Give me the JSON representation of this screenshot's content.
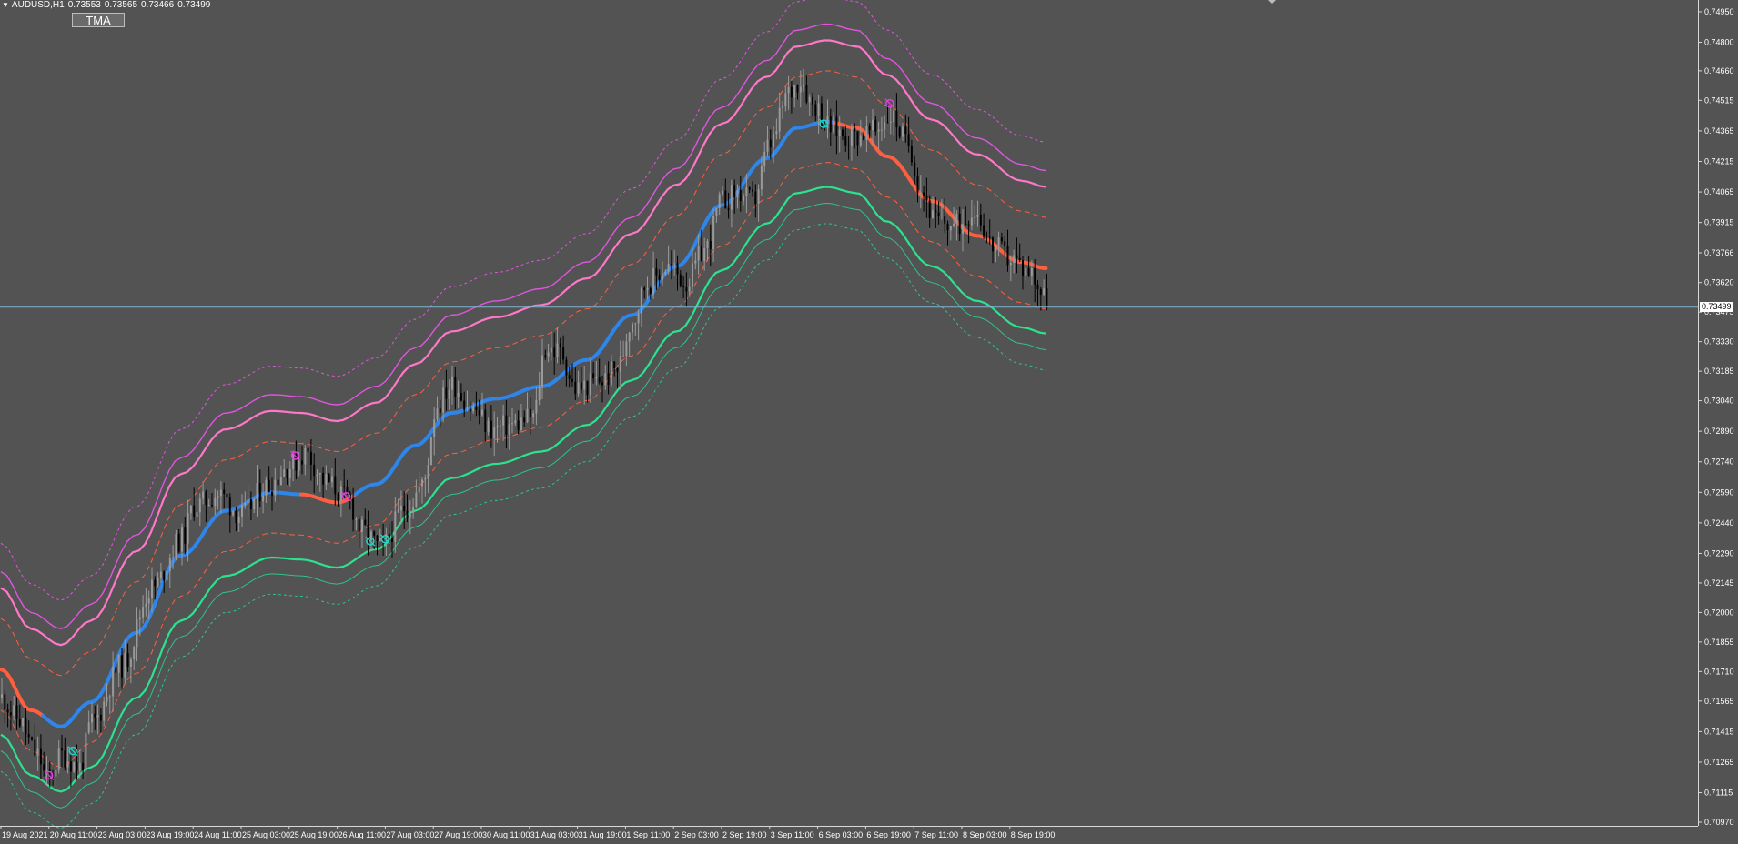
{
  "header": {
    "symbol": "AUDUSD,H1",
    "open": "0.73553",
    "high": "0.73565",
    "low": "0.73466",
    "close": "0.73499"
  },
  "indicator_button": {
    "label": "TMA"
  },
  "current_price_label": "0.73499",
  "colors": {
    "background": "#535353",
    "axis": "#d8d8d8",
    "bull_candle": "#9a9a9a",
    "bear_candle": "#000000",
    "mid_up": "#2f86ea",
    "mid_down": "#ff5f3f",
    "upper_1": "#ff77c8",
    "upper_2": "#e055e0",
    "lower_1": "#2de28f",
    "lower_2": "#2ec48a",
    "price_line": "#7eb3d1"
  },
  "chart_data": {
    "type": "candlestick",
    "title": "AUDUSD,H1",
    "ylim": [
      0.7097,
      0.7499
    ],
    "y_ticks": [
      "0.74950",
      "0.74800",
      "0.74660",
      "0.74515",
      "0.74365",
      "0.74215",
      "0.74065",
      "0.73915",
      "0.73766",
      "0.73620",
      "0.73475",
      "0.73330",
      "0.73185",
      "0.73040",
      "0.72890",
      "0.72740",
      "0.72590",
      "0.72440",
      "0.72290",
      "0.72145",
      "0.72000",
      "0.71855",
      "0.71710",
      "0.71565",
      "0.71415",
      "0.71265",
      "0.71115",
      "0.70970"
    ],
    "x_ticks": [
      "19 Aug 2021",
      "20 Aug 11:00",
      "23 Aug 03:00",
      "23 Aug 19:00",
      "24 Aug 11:00",
      "25 Aug 03:00",
      "25 Aug 19:00",
      "26 Aug 11:00",
      "27 Aug 03:00",
      "27 Aug 19:00",
      "30 Aug 11:00",
      "31 Aug 03:00",
      "31 Aug 19:00",
      "1 Sep 11:00",
      "2 Sep 03:00",
      "2 Sep 19:00",
      "3 Sep 11:00",
      "6 Sep 03:00",
      "6 Sep 19:00",
      "7 Sep 11:00",
      "8 Sep 03:00",
      "8 Sep 19:00"
    ],
    "x_tick_index": [
      0,
      16,
      32,
      48,
      64,
      80,
      96,
      112,
      128,
      144,
      160,
      176,
      192,
      208,
      224,
      240,
      256,
      272,
      288,
      304,
      320,
      336
    ],
    "bar_count": 356,
    "current_price": 0.73499,
    "tma_center_keypoints": [
      [
        0,
        0.7172
      ],
      [
        10,
        0.7152
      ],
      [
        20,
        0.7144
      ],
      [
        30,
        0.7156
      ],
      [
        45,
        0.719
      ],
      [
        60,
        0.7228
      ],
      [
        75,
        0.725
      ],
      [
        90,
        0.7259
      ],
      [
        100,
        0.7258
      ],
      [
        112,
        0.7254
      ],
      [
        125,
        0.7263
      ],
      [
        138,
        0.7282
      ],
      [
        150,
        0.7298
      ],
      [
        165,
        0.7305
      ],
      [
        180,
        0.7311
      ],
      [
        195,
        0.7324
      ],
      [
        210,
        0.7346
      ],
      [
        225,
        0.737
      ],
      [
        240,
        0.74
      ],
      [
        255,
        0.7423
      ],
      [
        265,
        0.7438
      ],
      [
        275,
        0.7441
      ],
      [
        285,
        0.7438
      ],
      [
        295,
        0.7424
      ],
      [
        310,
        0.7402
      ],
      [
        325,
        0.7385
      ],
      [
        340,
        0.7372
      ],
      [
        348,
        0.7369
      ]
    ],
    "band_offsets": {
      "upper_1": 0.004,
      "upper_2": 0.0048,
      "upper_3": 0.0062,
      "upper_inner": 0.0025,
      "lower_inner": -0.002,
      "lower_1": -0.0032,
      "lower_2": -0.004,
      "lower_3": -0.005
    },
    "tma_trend": [
      {
        "from": 0,
        "to": 14,
        "dir": "down"
      },
      {
        "from": 14,
        "to": 100,
        "dir": "up"
      },
      {
        "from": 100,
        "to": 118,
        "dir": "down"
      },
      {
        "from": 118,
        "to": 278,
        "dir": "up"
      },
      {
        "from": 278,
        "to": 348,
        "dir": "down"
      }
    ],
    "price_keypoints": [
      [
        0,
        0.7158
      ],
      [
        5,
        0.7148
      ],
      [
        12,
        0.713
      ],
      [
        15,
        0.7118
      ],
      [
        20,
        0.713
      ],
      [
        26,
        0.7124
      ],
      [
        30,
        0.7146
      ],
      [
        40,
        0.7174
      ],
      [
        50,
        0.7212
      ],
      [
        60,
        0.7236
      ],
      [
        64,
        0.7252
      ],
      [
        72,
        0.7258
      ],
      [
        80,
        0.7248
      ],
      [
        88,
        0.7262
      ],
      [
        96,
        0.7272
      ],
      [
        101,
        0.7278
      ],
      [
        108,
        0.7264
      ],
      [
        115,
        0.7256
      ],
      [
        120,
        0.724
      ],
      [
        126,
        0.7232
      ],
      [
        135,
        0.7252
      ],
      [
        140,
        0.7262
      ],
      [
        145,
        0.7302
      ],
      [
        150,
        0.7312
      ],
      [
        157,
        0.73
      ],
      [
        163,
        0.729
      ],
      [
        170,
        0.7292
      ],
      [
        177,
        0.7296
      ],
      [
        181,
        0.733
      ],
      [
        186,
        0.7328
      ],
      [
        191,
        0.731
      ],
      [
        200,
        0.7314
      ],
      [
        205,
        0.732
      ],
      [
        210,
        0.7344
      ],
      [
        215,
        0.7362
      ],
      [
        222,
        0.737
      ],
      [
        228,
        0.7362
      ],
      [
        234,
        0.7378
      ],
      [
        240,
        0.7402
      ],
      [
        245,
        0.7406
      ],
      [
        250,
        0.7402
      ],
      [
        256,
        0.743
      ],
      [
        262,
        0.7455
      ],
      [
        266,
        0.7462
      ],
      [
        270,
        0.745
      ],
      [
        276,
        0.7438
      ],
      [
        282,
        0.7434
      ],
      [
        290,
        0.7436
      ],
      [
        296,
        0.7444
      ],
      [
        302,
        0.743
      ],
      [
        306,
        0.7408
      ],
      [
        311,
        0.7392
      ],
      [
        318,
        0.739
      ],
      [
        324,
        0.7398
      ],
      [
        330,
        0.738
      ],
      [
        336,
        0.7374
      ],
      [
        342,
        0.7368
      ],
      [
        348,
        0.7354
      ]
    ],
    "markers": [
      {
        "bar": 16,
        "price": 0.712,
        "type": "sell"
      },
      {
        "bar": 24,
        "price": 0.7132,
        "type": "buy"
      },
      {
        "bar": 98,
        "price": 0.7277,
        "type": "sell"
      },
      {
        "bar": 115,
        "price": 0.7257,
        "type": "sell"
      },
      {
        "bar": 123,
        "price": 0.7235,
        "type": "buy"
      },
      {
        "bar": 128,
        "price": 0.7236,
        "type": "buy"
      },
      {
        "bar": 274,
        "price": 0.744,
        "type": "buy"
      },
      {
        "bar": 296,
        "price": 0.745,
        "type": "sell"
      }
    ]
  }
}
